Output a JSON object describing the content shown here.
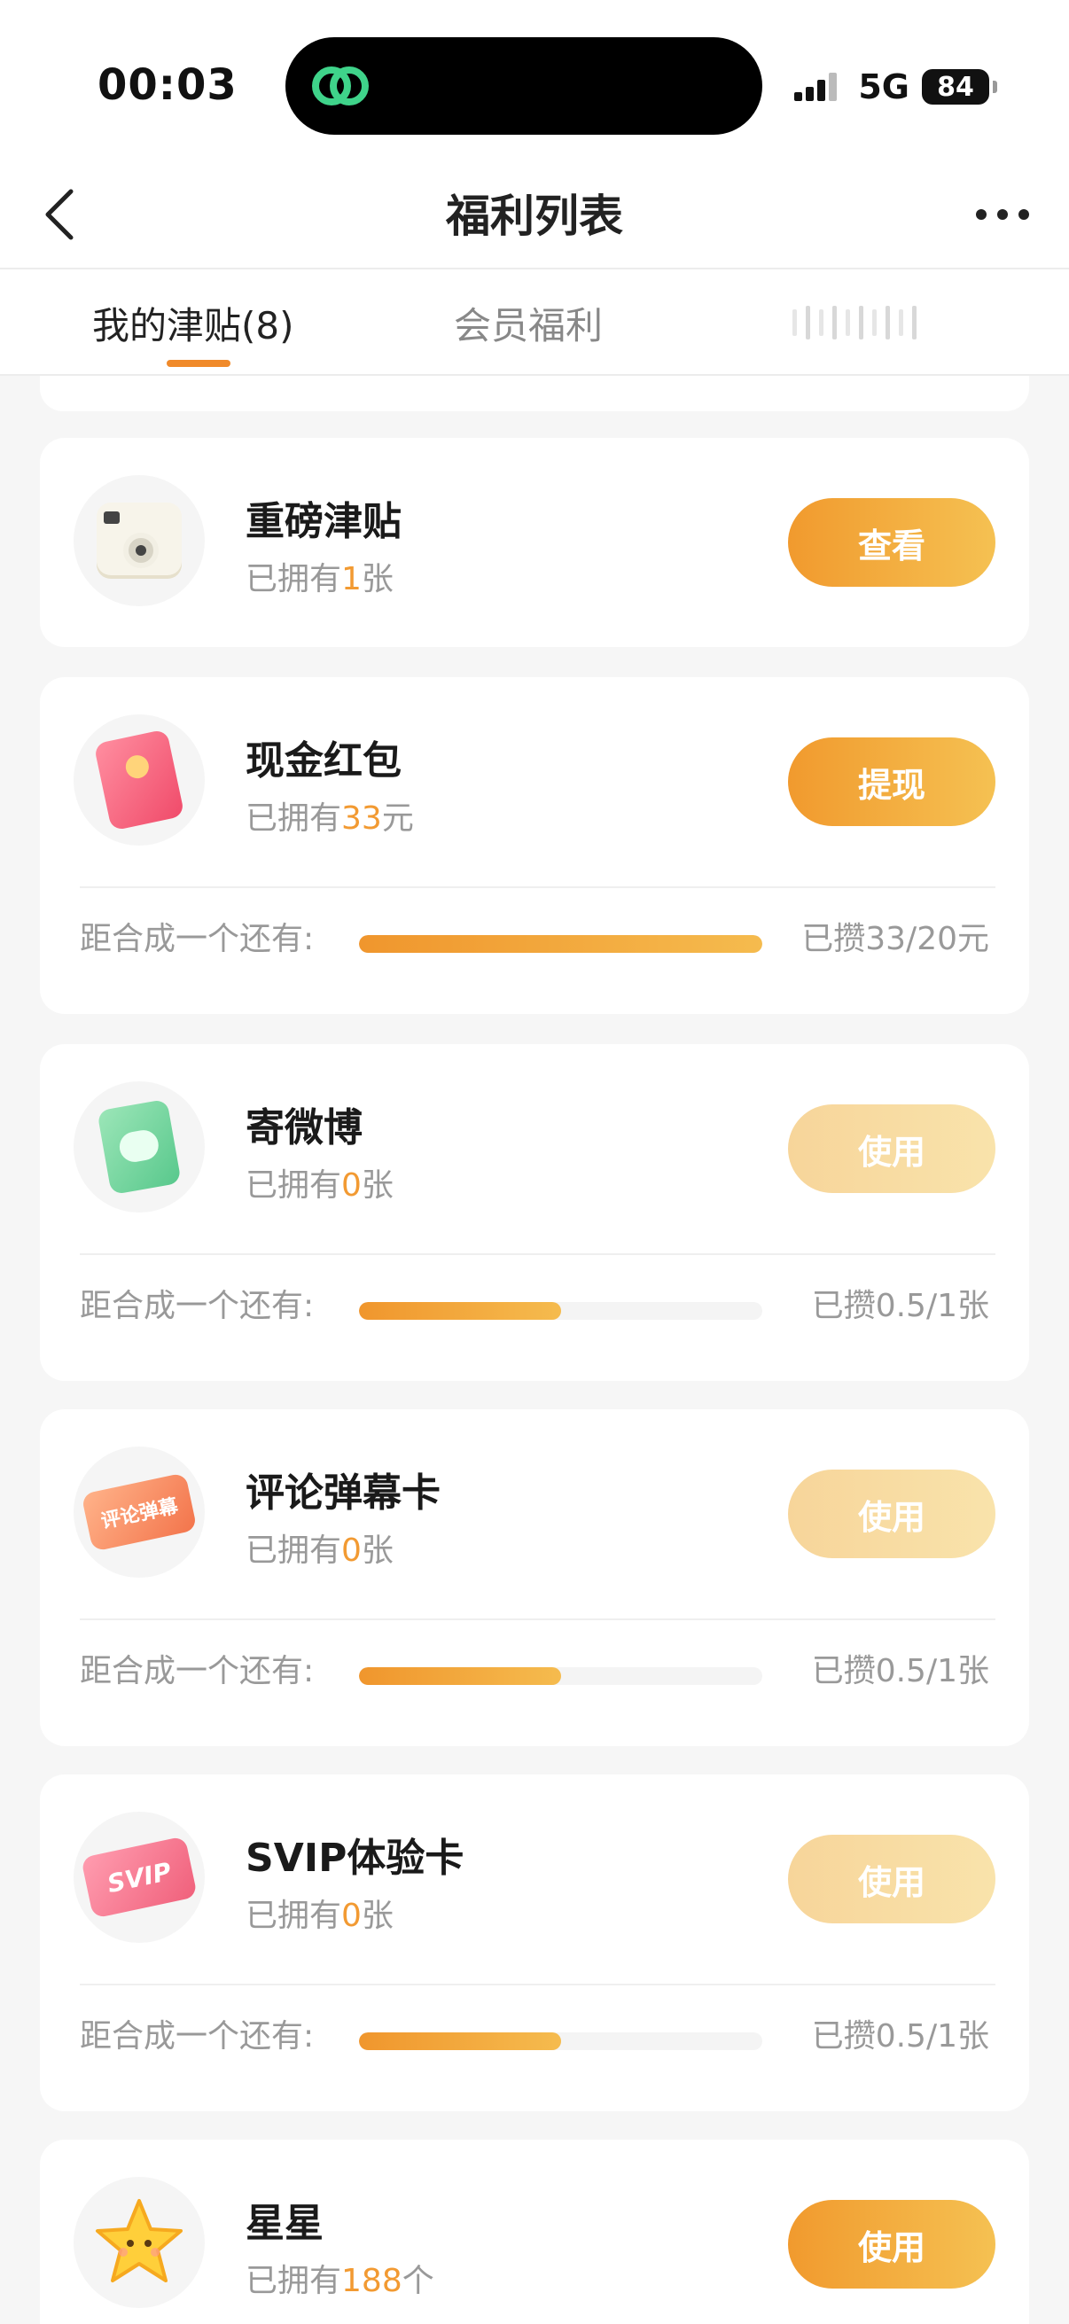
{
  "status_bar": {
    "time": "00:03",
    "network": "5G",
    "battery": "84"
  },
  "nav": {
    "title": "福利列表"
  },
  "tabs": [
    {
      "label": "我的津贴(8)",
      "active": true
    },
    {
      "label": "会员福利",
      "active": false
    }
  ],
  "items": [
    {
      "name": "重磅津贴",
      "owned_prefix": "已拥有",
      "owned_count": "1",
      "owned_unit": "张",
      "button": "查看",
      "button_enabled": true,
      "icon": "camera-icon"
    },
    {
      "name": "现金红包",
      "owned_prefix": "已拥有",
      "owned_count": "33",
      "owned_unit": "元",
      "button": "提现",
      "button_enabled": true,
      "icon": "red-packet-icon",
      "progress_label": "距合成一个还有:",
      "progress_value": "已攒33/20元",
      "progress_fraction": 1.0
    },
    {
      "name": "寄微博",
      "owned_prefix": "已拥有",
      "owned_count": "0",
      "owned_unit": "张",
      "button": "使用",
      "button_enabled": false,
      "icon": "weibo-card-icon",
      "progress_label": "距合成一个还有:",
      "progress_value": "已攒0.5/1张",
      "progress_fraction": 0.5
    },
    {
      "name": "评论弹幕卡",
      "owned_prefix": "已拥有",
      "owned_count": "0",
      "owned_unit": "张",
      "button": "使用",
      "button_enabled": false,
      "icon": "comment-danmu-card-icon",
      "icon_text": "评论弹幕",
      "progress_label": "距合成一个还有:",
      "progress_value": "已攒0.5/1张",
      "progress_fraction": 0.5
    },
    {
      "name": "SVIP体验卡",
      "owned_prefix": "已拥有",
      "owned_count": "0",
      "owned_unit": "张",
      "button": "使用",
      "button_enabled": false,
      "icon": "svip-card-icon",
      "icon_text": "SVIP",
      "progress_label": "距合成一个还有:",
      "progress_value": "已攒0.5/1张",
      "progress_fraction": 0.5
    },
    {
      "name": "星星",
      "owned_prefix": "已拥有",
      "owned_count": "188",
      "owned_unit": "个",
      "button": "使用",
      "button_enabled": true,
      "icon": "star-icon"
    }
  ],
  "colors": {
    "accent": "#f08a2a",
    "button_start": "#f19a2e",
    "button_end": "#f5c152",
    "count_highlight": "#f29a32"
  }
}
